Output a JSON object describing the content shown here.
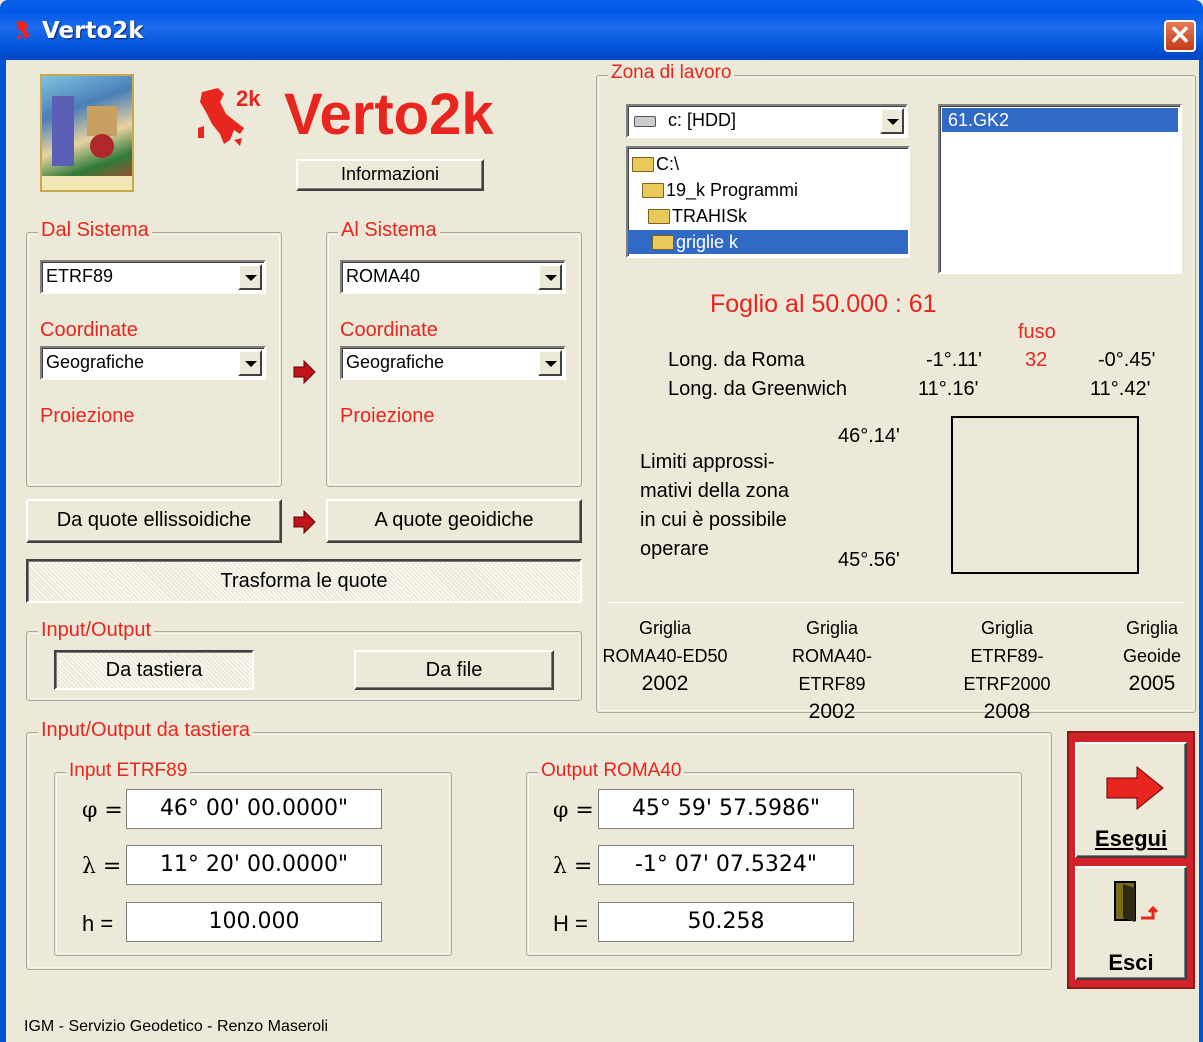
{
  "window": {
    "title": "Verto2k",
    "close": "✕"
  },
  "header": {
    "logo_2k": "2k",
    "logo_name": "Verto2k",
    "info_button": "Informazioni"
  },
  "dal": {
    "legend": "Dal Sistema",
    "system": "ETRF89",
    "coord_label": "Coordinate",
    "coord": "Geografiche",
    "proj_label": "Proiezione"
  },
  "al": {
    "legend": "Al Sistema",
    "system": "ROMA40",
    "coord_label": "Coordinate",
    "coord": "Geografiche",
    "proj_label": "Proiezione"
  },
  "quote": {
    "from": "Da quote ellissoidiche",
    "to": "A quote geoidiche",
    "transform": "Trasforma le quote"
  },
  "io": {
    "legend": "Input/Output",
    "keyboard": "Da tastiera",
    "file": "Da file"
  },
  "zona": {
    "legend": "Zona di lavoro",
    "drive": "c: [HDD]",
    "folders": [
      "C:\\",
      "19_k Programmi",
      "TRAHISk",
      "griglie k"
    ],
    "files": [
      "61.GK2"
    ],
    "foglio": "Foglio al 50.000 :  61",
    "fuso_label": "fuso",
    "fuso": "32",
    "long_roma_label": "Long. da Roma",
    "long_roma_min": "-1°.11'",
    "long_roma_max": "-0°.45'",
    "long_gw_label": "Long. da Greenwich",
    "long_gw_min": "11°.16'",
    "long_gw_max": "11°.42'",
    "lat_max": "46°.14'",
    "lat_min": "45°.56'",
    "limiti": [
      "Limiti approssi-",
      "mativi della zona",
      "in cui è possibile",
      "operare"
    ],
    "grids": [
      {
        "l1": "Griglia",
        "l2": "ROMA40-ED50",
        "year": "2002"
      },
      {
        "l1": "Griglia",
        "l2": "ROMA40-ETRF89",
        "year": "2002"
      },
      {
        "l1": "Griglia",
        "l2": "ETRF89-ETRF2000",
        "year": "2008"
      },
      {
        "l1": "Griglia",
        "l2": "Geoide",
        "year": "2005"
      }
    ]
  },
  "tastiera": {
    "legend": "Input/Output da tastiera",
    "input": {
      "legend": "Input  ETRF89",
      "phi_label": "φ =",
      "lambda_label": "λ =",
      "h_label": "h =",
      "phi": "46° 00' 00.0000\"",
      "lambda": "11° 20' 00.0000\"",
      "h": "100.000"
    },
    "output": {
      "legend": "Output  ROMA40",
      "phi_label": "φ =",
      "lambda_label": "λ =",
      "h_label": "H =",
      "phi": "45° 59' 57.5986\"",
      "lambda": "-1° 07' 07.5324\"",
      "h": "50.258"
    }
  },
  "actions": {
    "run": "Esegui",
    "exit": "Esci"
  },
  "footer": "IGM - Servizio Geodetico - Renzo Maseroli",
  "colors": {
    "accent": "#E8251E",
    "titlebar": "#0058E6",
    "face": "#ECE9D8",
    "selection": "#316AC5"
  }
}
